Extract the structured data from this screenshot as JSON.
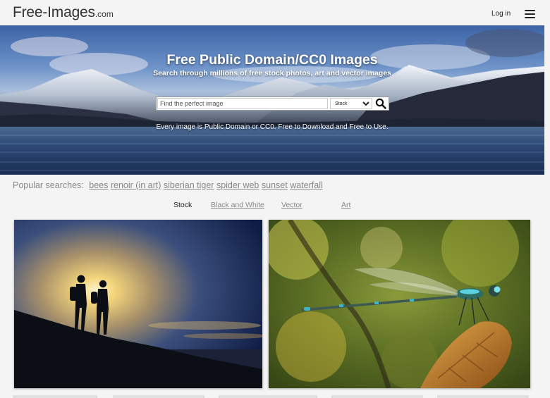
{
  "header": {
    "logo_main": "Free-Images",
    "logo_tld": ".com",
    "login_label": "Log in",
    "menu_icon": "hamburger-menu-icon"
  },
  "hero": {
    "title": "Free Public Domain/CC0 Images",
    "subtitle": "Search through millions of free stock photos, art and vector images",
    "search": {
      "placeholder": "Find the perfect image",
      "value": "",
      "type_selected": "Stock",
      "type_options": [
        "Stock"
      ],
      "button_icon": "search-icon"
    },
    "tagline": "Every image is Public Domain or CC0. Free to Download and Free to Use."
  },
  "popular": {
    "label": "Popular searches:",
    "terms": [
      "bees",
      "renoir (in art)",
      "siberian tiger",
      "spider web",
      "sunset",
      "waterfall"
    ]
  },
  "tabs": [
    {
      "label": "Stock",
      "active": true
    },
    {
      "label": "Black and White",
      "active": false
    },
    {
      "label": "Vector",
      "active": false
    },
    {
      "label": "Art",
      "active": false
    }
  ],
  "colors": {
    "background": "#f4f4f4",
    "text": "#333333",
    "muted_link": "#888888"
  }
}
